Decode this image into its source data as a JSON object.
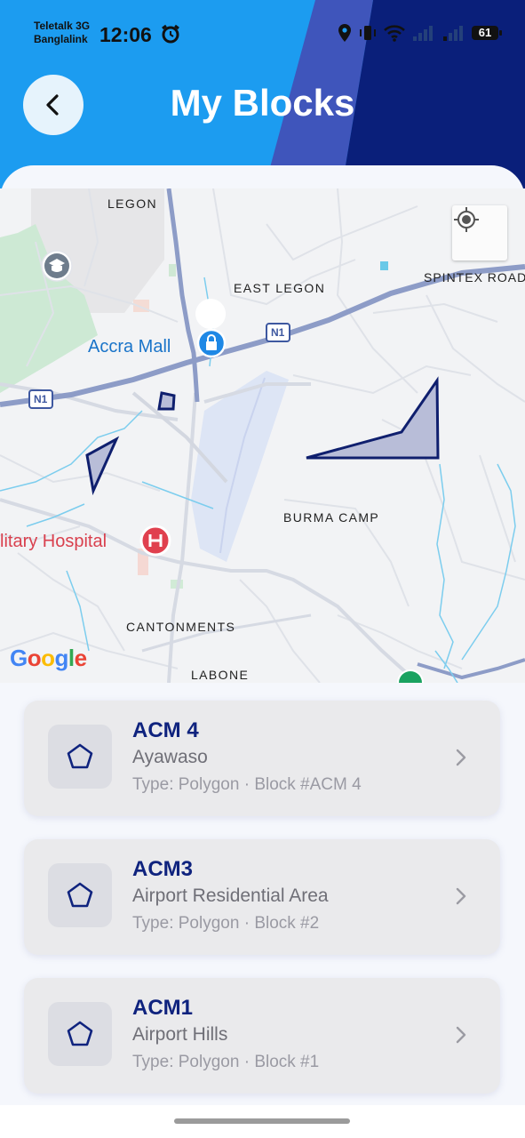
{
  "status_bar": {
    "carrier_line1": "Teletalk 3G",
    "carrier_line2": "Banglalink",
    "time": "12:06",
    "battery": "61"
  },
  "header": {
    "title": "My Blocks",
    "back_icon": "chevron-left-icon"
  },
  "map": {
    "labels": {
      "legon": "LEGON",
      "east_legon": "EAST LEGON",
      "spintex": "SPINTEX ROAD",
      "burma_camp": "BURMA CAMP",
      "cantonments": "CANTONMENTS",
      "labone": "LABONE",
      "n1_a": "N1",
      "n1_b": "N1"
    },
    "poi": {
      "accra_mall": "Accra Mall",
      "hospital": "litary Hospital"
    },
    "attribution": "Google",
    "colors": {
      "polygon_stroke": "#0f1f6e",
      "polygon_fill": "#b8bdd8",
      "hospital": "#e0404e",
      "mall": "#1e88e5"
    }
  },
  "blocks": [
    {
      "name": "ACM 4",
      "area": "Ayawaso",
      "type": "Type: Polygon",
      "sep": "·",
      "block": "Block #ACM 4"
    },
    {
      "name": "ACM3",
      "area": "Airport Residential Area",
      "type": "Type: Polygon",
      "sep": "·",
      "block": "Block #2"
    },
    {
      "name": "ACM1",
      "area": "Airport Hills",
      "type": "Type: Polygon",
      "sep": "·",
      "block": "Block #1"
    }
  ],
  "colors": {
    "header_blue": "#1c9cf0",
    "header_navy": "#0a1f7a",
    "accent_navy": "#0f237e"
  }
}
